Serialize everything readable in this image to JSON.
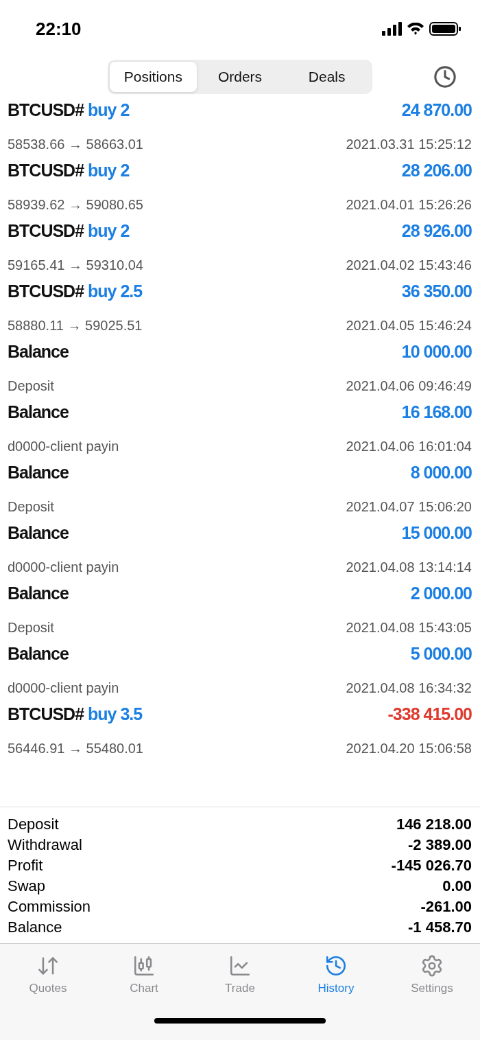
{
  "status_bar": {
    "time": "22:10"
  },
  "segments": [
    {
      "label": "Positions",
      "selected": true
    },
    {
      "label": "Orders",
      "selected": false
    },
    {
      "label": "Deals",
      "selected": false
    }
  ],
  "deals": [
    {
      "kind": "trade",
      "symbol": "BTCUSD#",
      "side": "buy 2",
      "detail": "58538.66 → 58663.01",
      "amount": "24 870.00",
      "color": "#1b7fe3",
      "time": "2021.03.31 15:25:12"
    },
    {
      "kind": "trade",
      "symbol": "BTCUSD#",
      "side": "buy 2",
      "detail": "58939.62 → 59080.65",
      "amount": "28 206.00",
      "color": "#1b7fe3",
      "time": "2021.04.01 15:26:26"
    },
    {
      "kind": "trade",
      "symbol": "BTCUSD#",
      "side": "buy 2",
      "detail": "59165.41 → 59310.04",
      "amount": "28 926.00",
      "color": "#1b7fe3",
      "time": "2021.04.02 15:43:46"
    },
    {
      "kind": "trade",
      "symbol": "BTCUSD#",
      "side": "buy 2.5",
      "detail": "58880.11 → 59025.51",
      "amount": "36 350.00",
      "color": "#1b7fe3",
      "time": "2021.04.05 15:46:24"
    },
    {
      "kind": "balance",
      "symbol": "Balance",
      "detail": "Deposit",
      "amount": "10 000.00",
      "color": "#1b7fe3",
      "time": "2021.04.06 09:46:49"
    },
    {
      "kind": "balance",
      "symbol": "Balance",
      "detail": "d0000-client payin",
      "amount": "16 168.00",
      "color": "#1b7fe3",
      "time": "2021.04.06 16:01:04"
    },
    {
      "kind": "balance",
      "symbol": "Balance",
      "detail": "Deposit",
      "amount": "8 000.00",
      "color": "#1b7fe3",
      "time": "2021.04.07 15:06:20"
    },
    {
      "kind": "balance",
      "symbol": "Balance",
      "detail": "d0000-client payin",
      "amount": "15 000.00",
      "color": "#1b7fe3",
      "time": "2021.04.08 13:14:14"
    },
    {
      "kind": "balance",
      "symbol": "Balance",
      "detail": "Deposit",
      "amount": "2 000.00",
      "color": "#1b7fe3",
      "time": "2021.04.08 15:43:05"
    },
    {
      "kind": "balance",
      "symbol": "Balance",
      "detail": "d0000-client payin",
      "amount": "5 000.00",
      "color": "#1b7fe3",
      "time": "2021.04.08 16:34:32"
    },
    {
      "kind": "trade",
      "symbol": "BTCUSD#",
      "side": "buy 3.5",
      "detail": "56446.91 → 55480.01",
      "amount": "-338 415.00",
      "color": "#e0392d",
      "time": "2021.04.20 15:06:58"
    }
  ],
  "summary": [
    {
      "label": "Deposit",
      "value": "146 218.00"
    },
    {
      "label": "Withdrawal",
      "value": "-2 389.00"
    },
    {
      "label": "Profit",
      "value": "-145 026.70"
    },
    {
      "label": "Swap",
      "value": "0.00"
    },
    {
      "label": "Commission",
      "value": "-261.00"
    },
    {
      "label": "Balance",
      "value": "-1 458.70"
    }
  ],
  "tab_bar": [
    {
      "label": "Quotes",
      "kind": "quotes",
      "selected": false
    },
    {
      "label": "Chart",
      "kind": "chart",
      "selected": false
    },
    {
      "label": "Trade",
      "kind": "trade",
      "selected": false
    },
    {
      "label": "History",
      "kind": "history",
      "selected": true
    },
    {
      "label": "Settings",
      "kind": "settings",
      "selected": false
    }
  ]
}
